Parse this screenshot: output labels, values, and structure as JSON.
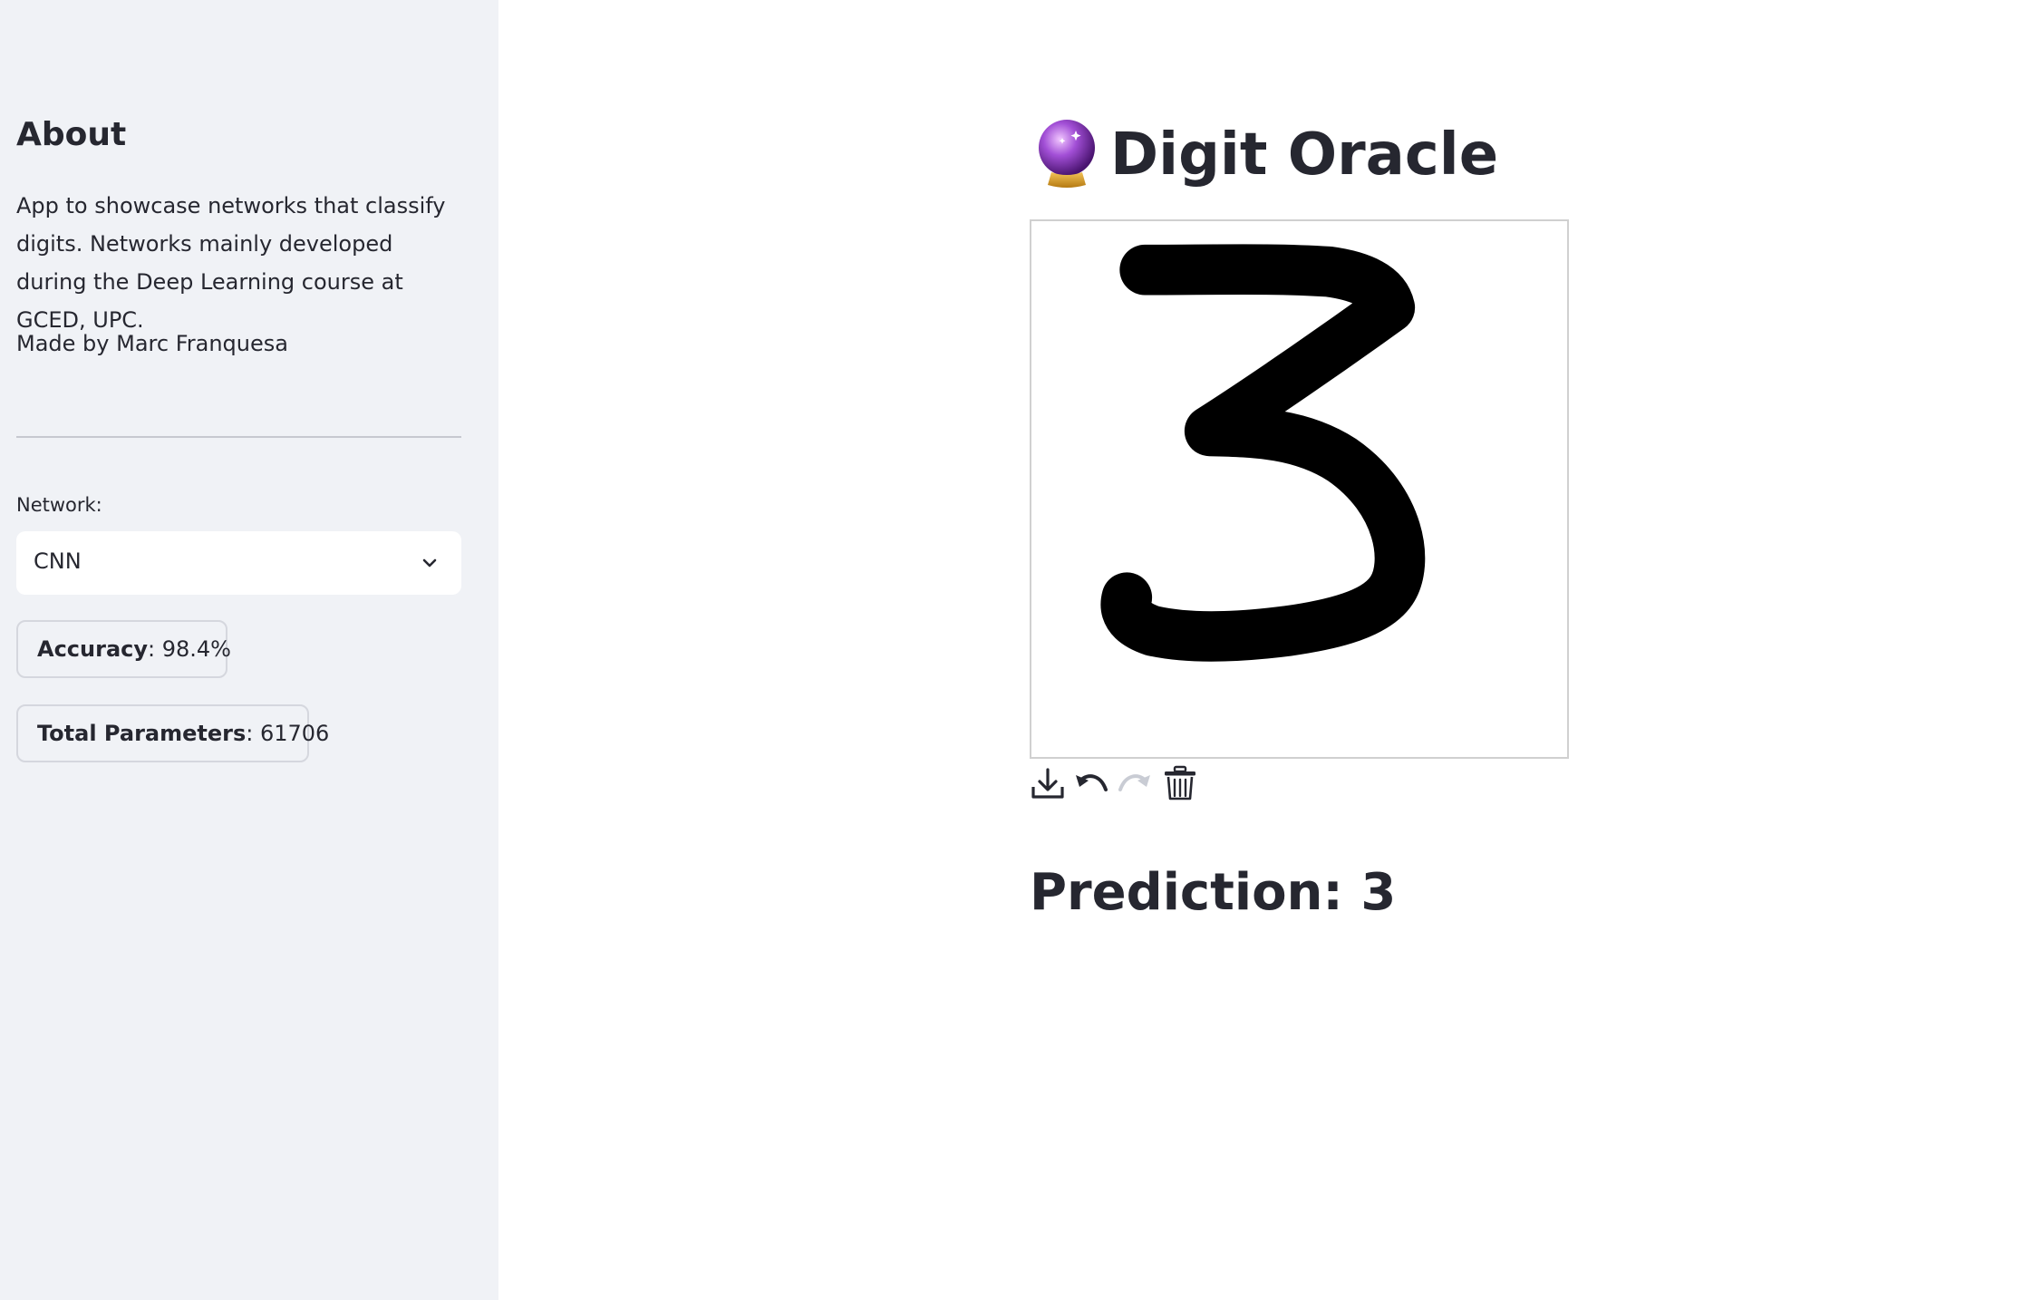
{
  "sidebar": {
    "heading": "About",
    "description": "App to showcase networks that classify digits. Networks mainly developed during the Deep Learning course at GCED, UPC.",
    "author": "Made by Marc Franquesa",
    "network_label": "Network:",
    "network_selected": "CNN",
    "accuracy_label": "Accuracy",
    "accuracy_value": "98.4%",
    "params_label": "Total Parameters",
    "params_value": "61706"
  },
  "main": {
    "title_emoji": "crystal-ball",
    "title": "Digit Oracle",
    "canvas": {
      "drawn_content": "handwritten digit 3",
      "stroke_color": "#000000",
      "background_color": "#ffffff"
    },
    "toolbar": [
      {
        "name": "download-icon",
        "enabled": true
      },
      {
        "name": "undo-icon",
        "enabled": true
      },
      {
        "name": "redo-icon",
        "enabled": false
      },
      {
        "name": "trash-icon",
        "enabled": true
      }
    ],
    "prediction_label": "Prediction:",
    "prediction_value": "3"
  },
  "colors": {
    "sidebar_bg": "#f0f2f6",
    "text": "#262730",
    "disabled_icon": "#c9ccd4"
  }
}
